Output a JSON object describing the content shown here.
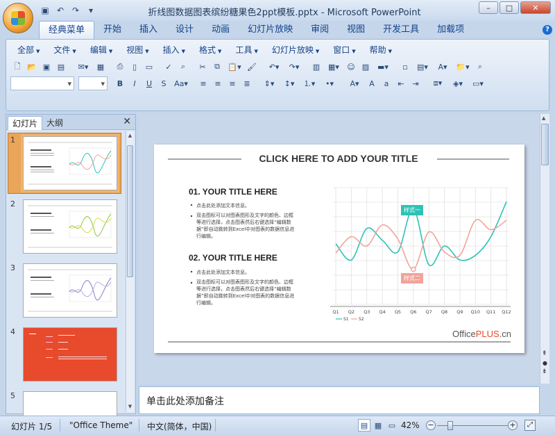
{
  "window": {
    "title": "折线图数据图表缤纷糖果色2ppt模板.pptx - Microsoft PowerPoint"
  },
  "qat": {
    "save": "save-icon",
    "undo": "undo-icon",
    "redo": "redo-icon"
  },
  "tabs": [
    "经典菜单",
    "开始",
    "插入",
    "设计",
    "动画",
    "幻灯片放映",
    "审阅",
    "视图",
    "开发工具",
    "加载项"
  ],
  "menubar": [
    "全部",
    "文件",
    "编辑",
    "视图",
    "插入",
    "格式",
    "工具",
    "幻灯片放映",
    "窗口",
    "帮助"
  ],
  "panel": {
    "tab_slides": "幻灯片",
    "tab_outline": "大纲",
    "slide_numbers": [
      "1",
      "2",
      "3",
      "4",
      "5"
    ]
  },
  "slide": {
    "title": "CLICK HERE TO ADD YOUR TITLE",
    "sec1_title": "01. YOUR TITLE HERE",
    "sec1_b1": "点击此处添加文本信息。",
    "sec1_b2": "双击图标可以对图表图形及文字的颜色、边框等进行选择，点击图表然后右键选择“编辑数据”即自动跳转到Excel中对图表的数据信息进行编辑。",
    "sec2_title": "02. YOUR TITLE HERE",
    "sec2_b1": "点击此处添加文本信息。",
    "sec2_b2": "双击图标可以对图表图形及文字的颜色、边框等进行选择，点击图表然后右键选择“编辑数据”即自动跳转到Excel中对图表的数据信息进行编辑。",
    "callout1": "样式一",
    "callout2": "样式二",
    "logo_office": "Office",
    "logo_plus": "PLUS",
    "logo_cn": ".cn"
  },
  "chart_data": {
    "type": "line",
    "categories": [
      "Q1",
      "Q2",
      "Q3",
      "Q4",
      "Q5",
      "Q6",
      "Q7",
      "Q8",
      "Q9",
      "Q10",
      "Q11",
      "Q12"
    ],
    "series": [
      {
        "name": "S1",
        "color": "#2cc3b5",
        "values": [
          52,
          38,
          65,
          55,
          45,
          82,
          34,
          50,
          38,
          42,
          58,
          88
        ]
      },
      {
        "name": "S2",
        "color": "#f0a49a",
        "values": [
          44,
          58,
          50,
          68,
          56,
          30,
          62,
          45,
          42,
          72,
          64,
          72
        ]
      }
    ],
    "ylim": [
      0,
      100
    ],
    "legend": "bottom-left",
    "grid": true
  },
  "notes": {
    "placeholder": "单击此处添加备注"
  },
  "status": {
    "slide": "幻灯片 1/5",
    "theme": "\"Office Theme\"",
    "lang": "中文(简体，中国)",
    "zoom": "42%"
  }
}
